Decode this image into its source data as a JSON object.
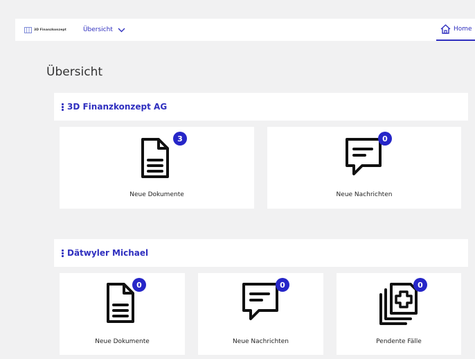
{
  "header": {
    "logo_text": "3D Finanzkonzept",
    "nav_overview_label": "Übersicht",
    "nav_home_label": "Home"
  },
  "page_title": "Übersicht",
  "sections": [
    {
      "title": "3D Finanzkonzept AG",
      "cards": [
        {
          "label": "Neue Dokumente",
          "badge": "3",
          "icon": "document-icon"
        },
        {
          "label": "Neue Nachrichten",
          "badge": "0",
          "icon": "message-icon"
        }
      ]
    },
    {
      "title": "Dätwyler Michael",
      "cards": [
        {
          "label": "Neue Dokumente",
          "badge": "0",
          "icon": "document-icon"
        },
        {
          "label": "Neue Nachrichten",
          "badge": "0",
          "icon": "message-icon"
        },
        {
          "label": "Pendente Fälle",
          "badge": "0",
          "icon": "case-plus-icon"
        }
      ]
    }
  ],
  "colors": {
    "accent": "#2f2fbf",
    "badge": "#2626c8",
    "background": "#f1f1f2",
    "card": "#ffffff"
  }
}
